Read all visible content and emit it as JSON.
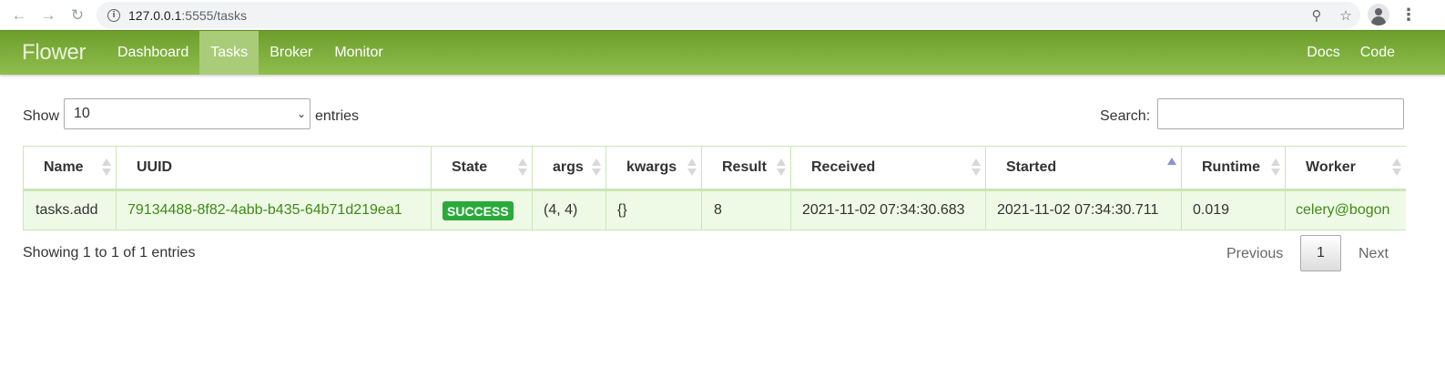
{
  "browser": {
    "url_host": "127.0.0.1",
    "url_path": ":5555/tasks",
    "icons": [
      "back-arrow-icon",
      "forward-arrow-icon",
      "reload-icon",
      "info-icon",
      "zoom-icon",
      "star-icon",
      "profile-icon",
      "menu-kebab-icon"
    ]
  },
  "navbar": {
    "brand": "Flower",
    "items": [
      {
        "label": "Dashboard"
      },
      {
        "label": "Tasks",
        "active": true
      },
      {
        "label": "Broker"
      },
      {
        "label": "Monitor"
      }
    ],
    "right_items": [
      {
        "label": "Docs"
      },
      {
        "label": "Code"
      }
    ],
    "colors": {
      "gradient_top": "#6d9e2c",
      "gradient_bottom": "#8fbd4d",
      "active_bg": "#a9cc79"
    }
  },
  "controls": {
    "show_label": "Show",
    "page_length": "10",
    "entries_label": "entries",
    "search_label": "Search:",
    "search_value": ""
  },
  "table": {
    "columns": [
      "Name",
      "UUID",
      "State",
      "args",
      "kwargs",
      "Result",
      "Received",
      "Started",
      "Runtime",
      "Worker"
    ],
    "sorted_column": "Started",
    "sort_direction": "ascending",
    "rows": [
      {
        "name": "tasks.add",
        "uuid": "79134488-8f82-4abb-b435-64b71d219ea1",
        "state": "SUCCESS",
        "args": "(4, 4)",
        "kwargs": "{}",
        "result": "8",
        "received": "2021-11-02 07:34:30.683",
        "started": "2021-11-02 07:34:30.711",
        "runtime": "0.019",
        "worker": "celery@bogon"
      }
    ],
    "colors": {
      "row_bg": "#eefae6",
      "border": "#c9e6b6",
      "link": "#3e8a16",
      "success_badge": "#2aaa3b"
    }
  },
  "footer": {
    "info": "Showing 1 to 1 of 1 entries",
    "previous": "Previous",
    "current_page": "1",
    "next": "Next"
  }
}
